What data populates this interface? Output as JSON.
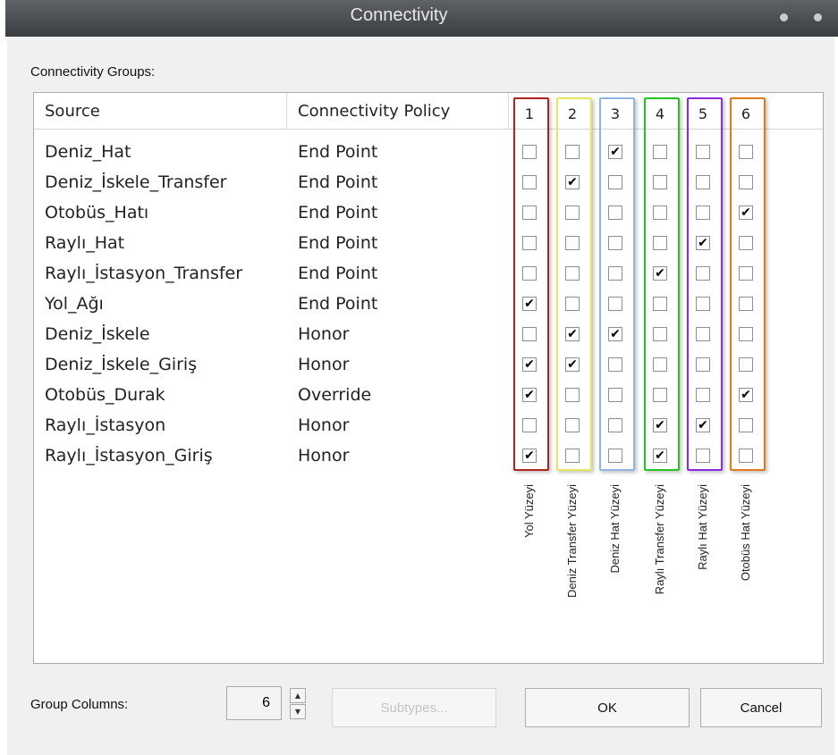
{
  "window": {
    "title": "Connectivity"
  },
  "labels": {
    "groups": "Connectivity Groups:",
    "group_columns": "Group Columns:"
  },
  "table": {
    "headers": {
      "source": "Source",
      "policy": "Connectivity Policy"
    },
    "group_numbers": [
      "1",
      "2",
      "3",
      "4",
      "5",
      "6"
    ],
    "group_names": [
      "Yol Yüzeyi",
      "Deniz Transfer Yüzeyi",
      "Deniz Hat Yüzeyi",
      "Raylı Transfer Yüzeyi",
      "Raylı Hat Yüzeyi",
      "Otobüs Hat Yüzeyi"
    ],
    "group_colors": [
      "#b22222",
      "#e6e65c",
      "#8fb4e3",
      "#22c522",
      "#8a2be2",
      "#e67817"
    ],
    "rows": [
      {
        "source": "Deniz_Hat",
        "policy": "End Point",
        "checks": [
          false,
          false,
          true,
          false,
          false,
          false
        ]
      },
      {
        "source": "Deniz_İskele_Transfer",
        "policy": "End Point",
        "checks": [
          false,
          true,
          false,
          false,
          false,
          false
        ]
      },
      {
        "source": "Otobüs_Hatı",
        "policy": "End Point",
        "checks": [
          false,
          false,
          false,
          false,
          false,
          true
        ]
      },
      {
        "source": "Raylı_Hat",
        "policy": "End Point",
        "checks": [
          false,
          false,
          false,
          false,
          true,
          false
        ]
      },
      {
        "source": "Raylı_İstasyon_Transfer",
        "policy": "End Point",
        "checks": [
          false,
          false,
          false,
          true,
          false,
          false
        ]
      },
      {
        "source": "Yol_Ağı",
        "policy": "End Point",
        "checks": [
          true,
          false,
          false,
          false,
          false,
          false
        ]
      },
      {
        "source": "Deniz_İskele",
        "policy": "Honor",
        "checks": [
          false,
          true,
          true,
          false,
          false,
          false
        ]
      },
      {
        "source": "Deniz_İskele_Giriş",
        "policy": "Honor",
        "checks": [
          true,
          true,
          false,
          false,
          false,
          false
        ]
      },
      {
        "source": "Otobüs_Durak",
        "policy": "Override",
        "checks": [
          true,
          false,
          false,
          false,
          false,
          true
        ]
      },
      {
        "source": "Raylı_İstasyon",
        "policy": "Honor",
        "checks": [
          false,
          false,
          false,
          true,
          true,
          false
        ]
      },
      {
        "source": "Raylı_İstasyon_Giriş",
        "policy": "Honor",
        "checks": [
          true,
          false,
          false,
          true,
          false,
          false
        ]
      }
    ]
  },
  "group_columns_value": "6",
  "buttons": {
    "subtypes": "Subtypes...",
    "ok": "OK",
    "cancel": "Cancel"
  }
}
